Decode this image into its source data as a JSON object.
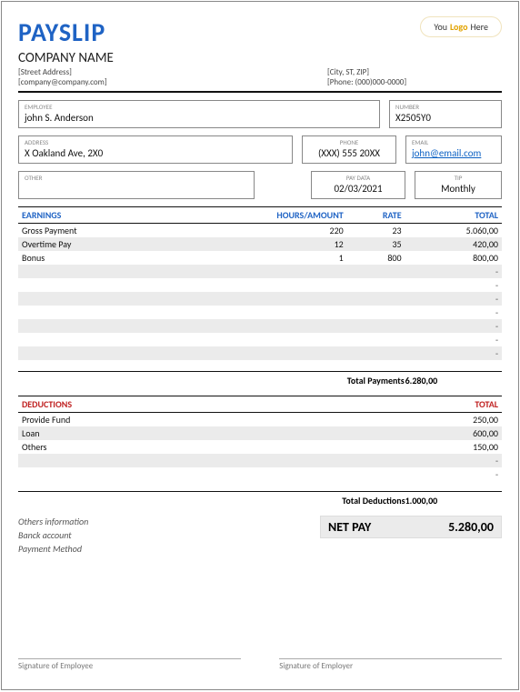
{
  "header": {
    "title": "PAYSLIP",
    "logo_pre": "You",
    "logo_word": "Logo",
    "logo_post": "Here",
    "company_name": "COMPANY NAME",
    "address": "[Street Address]",
    "city": "[City, ST, ZIP]",
    "email": "[company@company.com]",
    "phone": "[Phone: (000)000-0000]"
  },
  "fields": {
    "employee_label": "EMPLOYEE",
    "employee_value": "john S. Anderson",
    "number_label": "NUMBER",
    "number_value": "X2505Y0",
    "address_label": "ADDRESS",
    "address_value": "X Oakland Ave, 2X0",
    "phone_label": "PHONE",
    "phone_value": "(XXX) 555 20XX",
    "email_label": "EMAIL",
    "email_value": "john@email.com",
    "other_label": "OTHER",
    "other_value": "",
    "paydata_label": "PAY DATA",
    "paydata_value": "02/03/2021",
    "tip_label": "TIP",
    "tip_value": "Monthly"
  },
  "earnings": {
    "header": [
      "EARNINGS",
      "HOURS/AMOUNT",
      "RATE",
      "TOTAL"
    ],
    "rows": [
      {
        "name": "Gross Payment",
        "hours": "220",
        "rate": "23",
        "total": "5.060,00"
      },
      {
        "name": "Overtime Pay",
        "hours": "12",
        "rate": "35",
        "total": "420,00"
      },
      {
        "name": "Bonus",
        "hours": "1",
        "rate": "800",
        "total": "800,00"
      }
    ],
    "empty_count": 7,
    "total_label": "Total Payments",
    "total_value": "6.280,00"
  },
  "deductions": {
    "header": [
      "DEDUCTIONS",
      "TOTAL"
    ],
    "rows": [
      {
        "name": "Provide Fund",
        "total": "250,00"
      },
      {
        "name": "Loan",
        "total": "600,00"
      },
      {
        "name": "Others",
        "total": "150,00"
      }
    ],
    "empty_count": 2,
    "total_label": "Total Deductions",
    "total_value": "1.000,00"
  },
  "others_info": {
    "heading": "Others information",
    "lines": [
      "Banck account",
      "Payment Method"
    ]
  },
  "netpay": {
    "label": "NET PAY",
    "value": "5.280,00"
  },
  "signatures": {
    "employee": "Signature of Employee",
    "employer": "Signature of Employer"
  },
  "dash": "-"
}
